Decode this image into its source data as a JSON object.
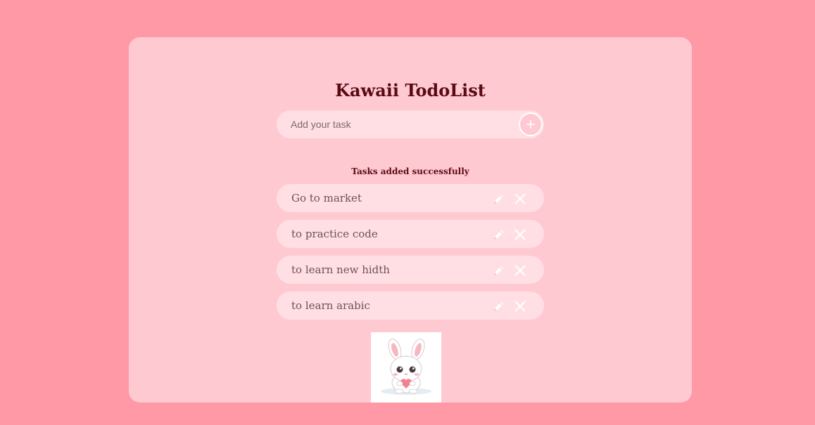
{
  "app": {
    "title": "Kawaii TodoList"
  },
  "input": {
    "placeholder": "Add your task",
    "value": ""
  },
  "add_button": {
    "icon": "plus-icon"
  },
  "status_message": "Tasks added successfully",
  "tasks": [
    {
      "label": "Go to market",
      "edit_icon": "pencil-icon",
      "delete_icon": "close-icon"
    },
    {
      "label": "to practice code",
      "edit_icon": "pencil-icon",
      "delete_icon": "close-icon"
    },
    {
      "label": "to learn new hidth",
      "edit_icon": "pencil-icon",
      "delete_icon": "close-icon"
    },
    {
      "label": "to learn arabic",
      "edit_icon": "pencil-icon",
      "delete_icon": "close-icon"
    }
  ],
  "illustration": {
    "name": "bunny-holding-heart"
  },
  "colors": {
    "page_background": "#ff99a6",
    "card_background": "#ffc9d2",
    "field_background": "#ffdfe4",
    "heading_text": "#5a0a12",
    "task_text": "#6b5357",
    "icon": "#ffffff"
  }
}
